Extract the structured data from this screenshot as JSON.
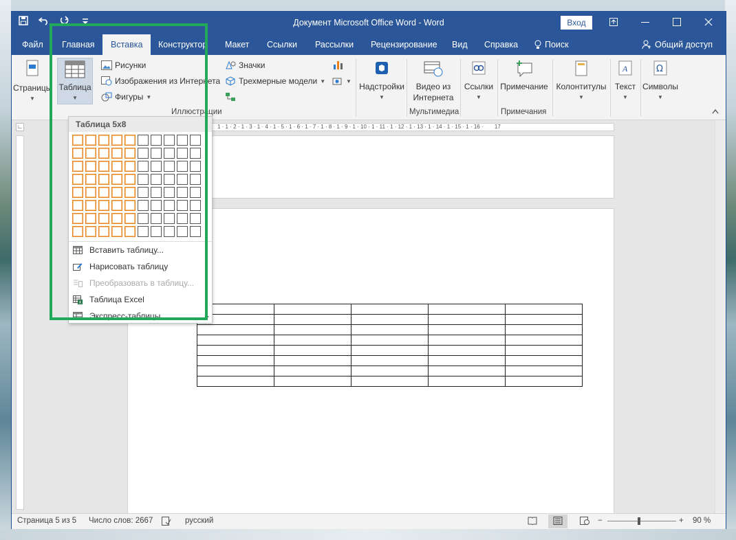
{
  "window": {
    "title": "Документ Microsoft Office Word  -  Word",
    "signin_label": "Вход",
    "share_label": "Общий доступ",
    "search_label": "Поиск"
  },
  "tabs": [
    {
      "label": "Файл",
      "active": false
    },
    {
      "label": "Главная",
      "active": false
    },
    {
      "label": "Вставка",
      "active": true
    },
    {
      "label": "Конструктор",
      "active": false
    },
    {
      "label": "Макет",
      "active": false
    },
    {
      "label": "Ссылки",
      "active": false
    },
    {
      "label": "Рассылки",
      "active": false
    },
    {
      "label": "Рецензирование",
      "active": false
    },
    {
      "label": "Вид",
      "active": false
    },
    {
      "label": "Справка",
      "active": false
    }
  ],
  "ribbon": {
    "pages_label": "Страницы",
    "table_label": "Таблица",
    "pictures_label": "Рисунки",
    "online_images_label": "Изображения из Интернета",
    "shapes_label": "Фигуры",
    "icons_label": "Значки",
    "models_label": "Трехмерные модели",
    "illustrations_group": "Иллюстрации",
    "addins_label": "Надстройки",
    "online_video_line1": "Видео из",
    "online_video_line2": "Интернета",
    "multimedia_group": "Мультимедиа",
    "links_label": "Ссылки",
    "comment_label": "Примечание",
    "comments_group": "Примечания",
    "header_footer_label": "Колонтитулы",
    "text_label": "Текст",
    "symbols_label": "Символы"
  },
  "dropdown": {
    "header": "Таблица 5x8",
    "grid_cols": 10,
    "grid_rows": 8,
    "selected_cols": 5,
    "selected_rows": 8,
    "items": [
      {
        "label": "Вставить таблицу...",
        "icon": "table-icon",
        "disabled": false
      },
      {
        "label": "Нарисовать таблицу",
        "icon": "pencil-table-icon",
        "disabled": false
      },
      {
        "label": "Преобразовать в таблицу...",
        "icon": "convert-table-icon",
        "disabled": true
      },
      {
        "label": "Таблица Excel",
        "icon": "excel-table-icon",
        "disabled": false
      },
      {
        "label": "Экспресс-таблицы",
        "icon": "quick-tables-icon",
        "disabled": false,
        "submenu": true
      }
    ]
  },
  "ruler": {
    "marks": "1 · 1 · 2 · 1 · 3 · 1 · 4 · 1 · 5 · 1 · 6 · 1 · 7 · 1 · 8 · 1 · 9 · 1 · 10 · 1 · 11 · 1 · 12 · 1 · 13 · 1 · 14 · 1 · 15 · 1 · 16 ·",
    "end_mark": "17"
  },
  "document": {
    "table_cols": 5,
    "table_rows": 8
  },
  "status": {
    "page": "Страница 5 из 5",
    "words": "Число слов: 2667",
    "language": "русский",
    "zoom": "90 %"
  },
  "colors": {
    "word_blue": "#2b579a",
    "selection_orange": "#e8821e",
    "highlight_green": "#21a85a"
  }
}
